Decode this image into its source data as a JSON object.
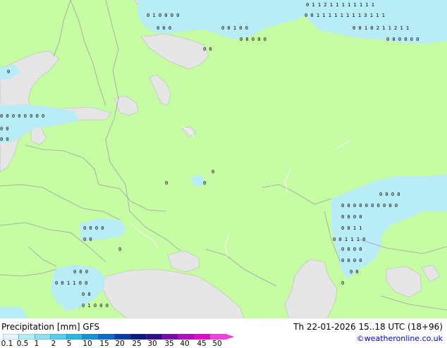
{
  "legend": {
    "title": "Precipitation [mm]",
    "model": "GFS",
    "ticks": [
      "0.1",
      "0.5",
      "1",
      "2",
      "5",
      "10",
      "15",
      "20",
      "25",
      "30",
      "35",
      "40",
      "45",
      "50"
    ],
    "colors": [
      "#e0f6fb",
      "#b4ecf8",
      "#8ae0f3",
      "#58cdec",
      "#2ab4e3",
      "#1492d6",
      "#0a6cc8",
      "#0a3ca8",
      "#081a88",
      "#2e0d8e",
      "#7a0ab0",
      "#b40ac0",
      "#e00ad0",
      "#f040e0"
    ]
  },
  "valid_time": "Th 22-01-2026 15..18 UTC (18+96)",
  "credit": "©weatheronline.co.uk",
  "colors": {
    "land": "#c6fca4",
    "sea": "#e6e6e6",
    "precip_light": "#b8ecf6",
    "border": "#a0a0a0"
  }
}
